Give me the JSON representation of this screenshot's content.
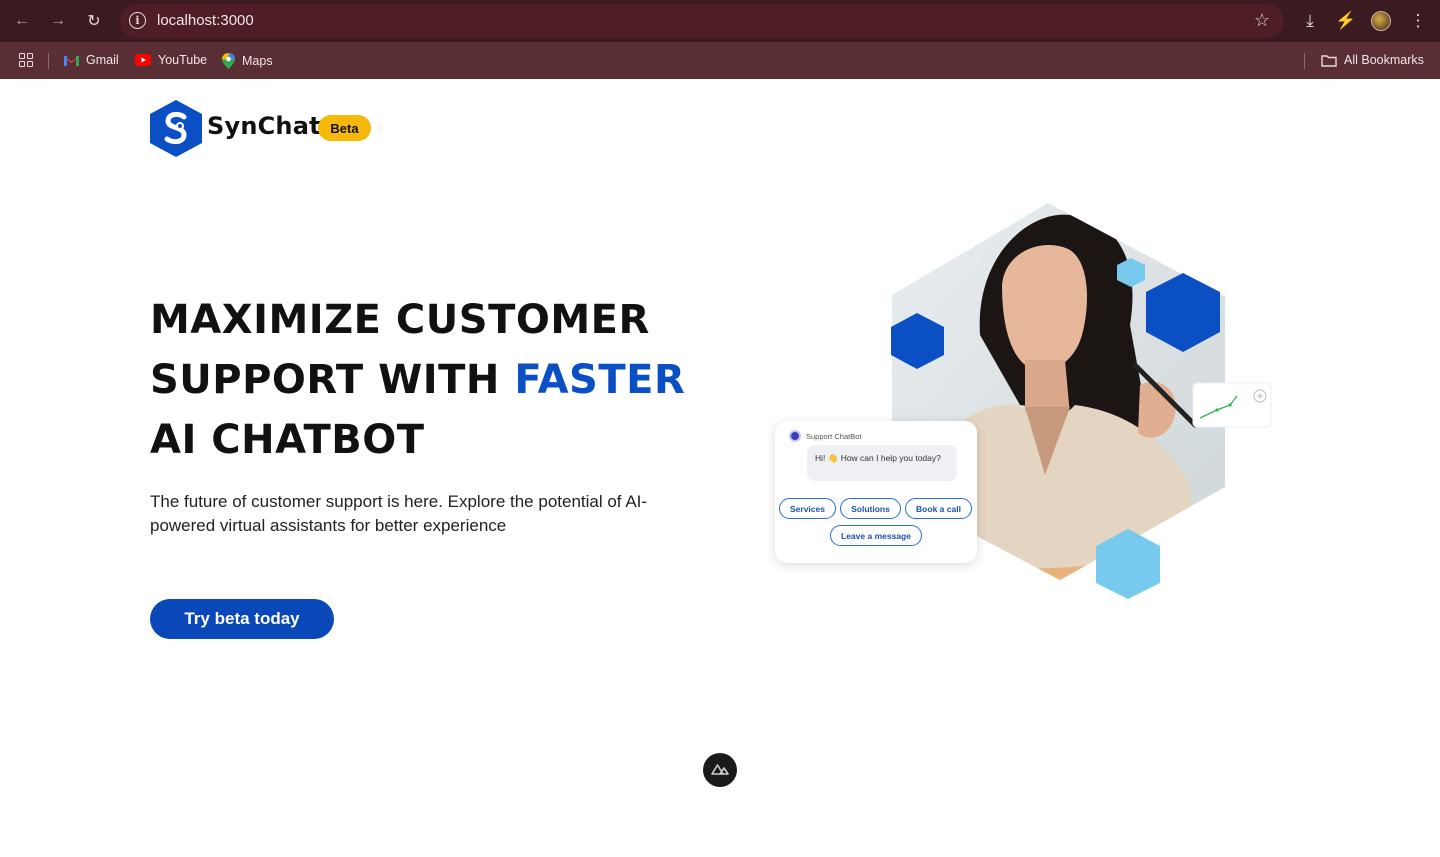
{
  "browser": {
    "url": "localhost:3000",
    "bookmarks": [
      {
        "label": "Gmail",
        "icon": "gmail-icon"
      },
      {
        "label": "YouTube",
        "icon": "youtube-icon"
      },
      {
        "label": "Maps",
        "icon": "maps-icon"
      }
    ],
    "all_bookmarks_label": "All Bookmarks"
  },
  "brand": {
    "name": "SynChat",
    "badge": "Beta",
    "logo_color": "#0a4fc4",
    "badge_color": "#f6b90a"
  },
  "hero": {
    "headline_line1": "MAXIMIZE CUSTOMER",
    "headline_line2_prefix": "SUPPORT WITH ",
    "headline_accent": "FASTER",
    "headline_line3": "AI CHATBOT",
    "accent_color": "#0a4fc4",
    "subtext": "The future of customer support is here. Explore the potential of AI-powered virtual assistants for better experience",
    "cta_label": "Try beta today",
    "cta_color": "#0a47b9"
  },
  "chat_widget": {
    "title": "Support ChatBot",
    "greeting": "Hi! 👋 How can I help you today?",
    "chips": [
      "Services",
      "Solutions",
      "Book a call",
      "Leave a message"
    ]
  }
}
